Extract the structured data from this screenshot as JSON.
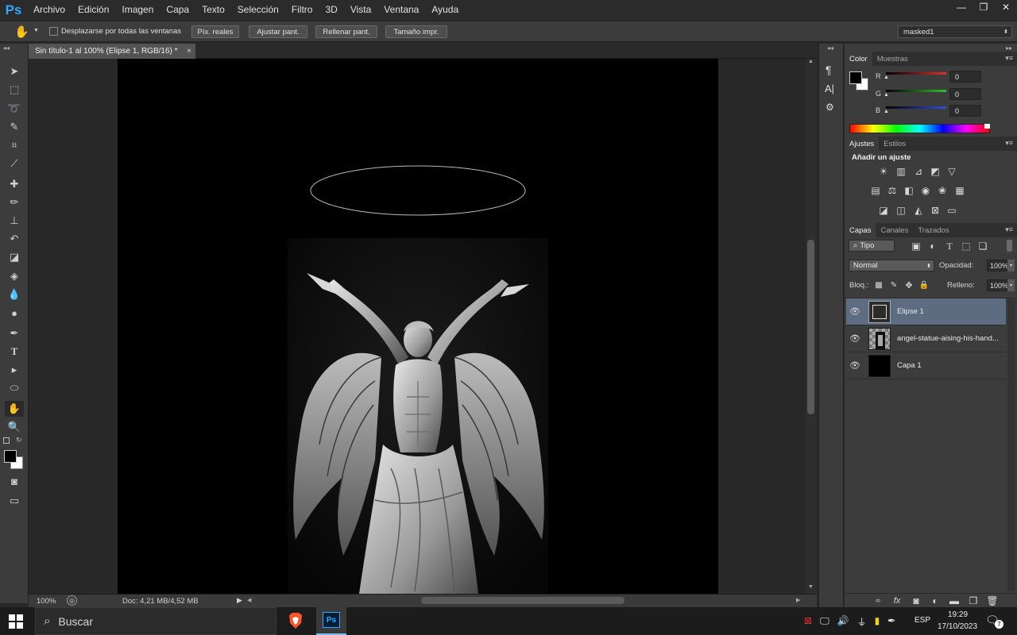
{
  "app": {
    "logo": "Ps",
    "accent": "#31a8ff"
  },
  "menu": [
    "Archivo",
    "Edición",
    "Imagen",
    "Capa",
    "Texto",
    "Selección",
    "Filtro",
    "3D",
    "Vista",
    "Ventana",
    "Ayuda"
  ],
  "window_controls": {
    "minimize": "—",
    "restore": "❐",
    "close": "✕"
  },
  "options": {
    "scroll_all_label": "Desplazarse por todas las ventanas",
    "buttons": [
      "Píx. reales",
      "Ajustar pant.",
      "Rellenar pant.",
      "Tamaño impr."
    ],
    "workspace": "masked1"
  },
  "document": {
    "tab_title": "Sin título-1 al 100% (Elipse 1, RGB/16) *",
    "close": "×",
    "zoom": "100%",
    "doc_size": "Doc: 4,21 MB/4,52 MB"
  },
  "color_panel": {
    "tabs": [
      "Color",
      "Muestras"
    ],
    "channels": [
      {
        "label": "R",
        "value": "0",
        "color": "#e03030"
      },
      {
        "label": "G",
        "value": "0",
        "color": "#30c030"
      },
      {
        "label": "B",
        "value": "0",
        "color": "#3050e0"
      }
    ]
  },
  "adjustments_panel": {
    "tabs": [
      "Ajustes",
      "Estilos"
    ],
    "title": "Añadir un ajuste"
  },
  "layers_panel": {
    "tabs": [
      "Capas",
      "Canales",
      "Trazados"
    ],
    "filter": "Tipo",
    "blend_mode": "Normal",
    "opacity_label": "Opacidad:",
    "opacity": "100%",
    "lock_label": "Bloq.:",
    "fill_label": "Relleno:",
    "fill": "100%",
    "layers": [
      {
        "name": "Elipse 1",
        "selected": true
      },
      {
        "name": "angel-statue-aising-his-hand...",
        "selected": false
      },
      {
        "name": "Capa 1",
        "selected": false
      }
    ]
  },
  "taskbar": {
    "search_placeholder": "Buscar",
    "language": "ESP",
    "time": "19:29",
    "date": "17/10/2023",
    "notifications": "7"
  }
}
